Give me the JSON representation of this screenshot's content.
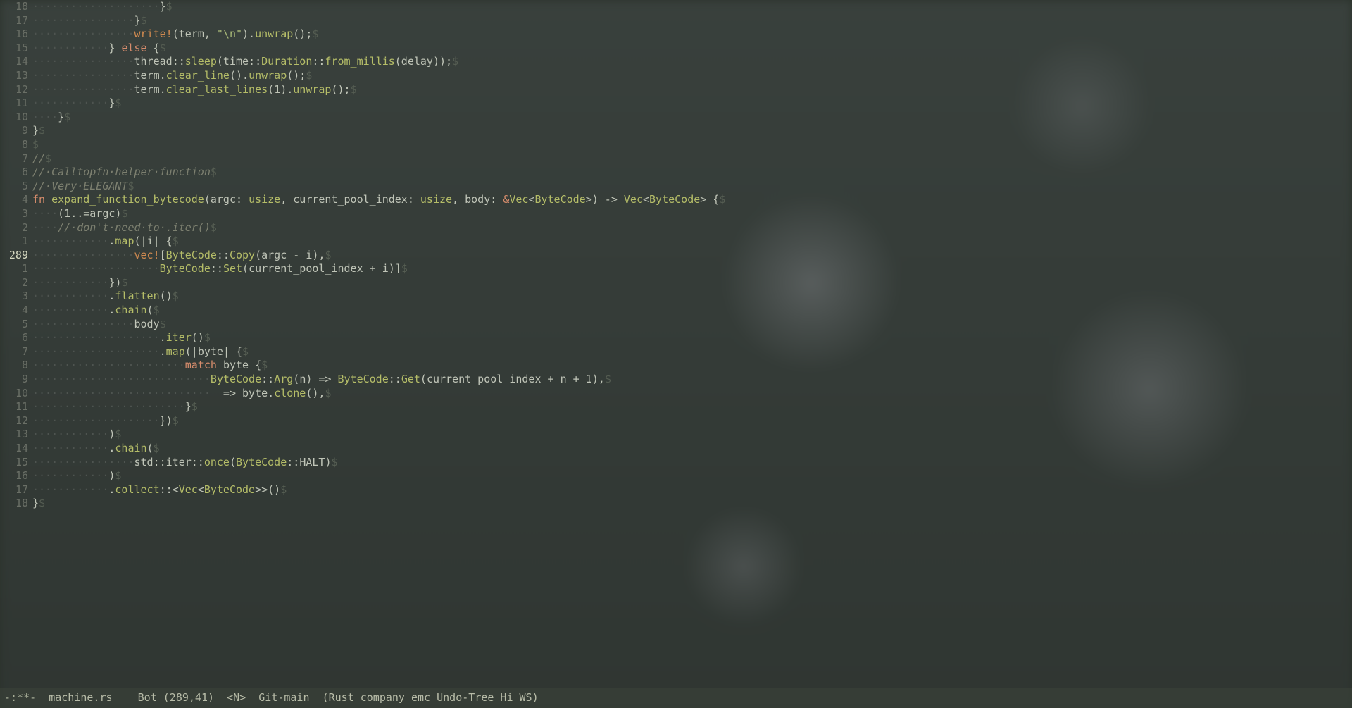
{
  "modeline": {
    "modified": "-:**-",
    "filename": "machine.rs",
    "position": "Bot (289,41)",
    "state": "<N>",
    "vcs": "Git-main",
    "modes": "(Rust company emc Undo-Tree Hi WS)"
  },
  "cursor_line_number": "289",
  "lines": [
    {
      "rel": "18",
      "indent": 20,
      "tokens": [
        {
          "cls": "op",
          "t": "}"
        }
      ]
    },
    {
      "rel": "17",
      "indent": 16,
      "tokens": [
        {
          "cls": "op",
          "t": "}"
        }
      ]
    },
    {
      "rel": "16",
      "indent": 16,
      "tokens": [
        {
          "cls": "mac",
          "t": "write!"
        },
        {
          "cls": "op",
          "t": "(term, "
        },
        {
          "cls": "str",
          "t": "\"\\n\""
        },
        {
          "cls": "op",
          "t": ")."
        },
        {
          "cls": "fn",
          "t": "unwrap"
        },
        {
          "cls": "op",
          "t": "();"
        }
      ]
    },
    {
      "rel": "15",
      "indent": 12,
      "tokens": [
        {
          "cls": "op",
          "t": "} "
        },
        {
          "cls": "kw",
          "t": "else"
        },
        {
          "cls": "op",
          "t": " {"
        }
      ]
    },
    {
      "rel": "14",
      "indent": 16,
      "tokens": [
        {
          "cls": "id",
          "t": "thread"
        },
        {
          "cls": "op",
          "t": "::"
        },
        {
          "cls": "fn",
          "t": "sleep"
        },
        {
          "cls": "op",
          "t": "(time::"
        },
        {
          "cls": "ty",
          "t": "Duration"
        },
        {
          "cls": "op",
          "t": "::"
        },
        {
          "cls": "fn",
          "t": "from_millis"
        },
        {
          "cls": "op",
          "t": "(delay));"
        }
      ]
    },
    {
      "rel": "13",
      "indent": 16,
      "tokens": [
        {
          "cls": "id",
          "t": "term"
        },
        {
          "cls": "op",
          "t": "."
        },
        {
          "cls": "fn",
          "t": "clear_line"
        },
        {
          "cls": "op",
          "t": "()"
        },
        {
          "cls": "op",
          "t": "."
        },
        {
          "cls": "fn",
          "t": "unwrap"
        },
        {
          "cls": "op",
          "t": "();"
        }
      ]
    },
    {
      "rel": "12",
      "indent": 16,
      "tokens": [
        {
          "cls": "id",
          "t": "term"
        },
        {
          "cls": "op",
          "t": "."
        },
        {
          "cls": "fn",
          "t": "clear_last_lines"
        },
        {
          "cls": "op",
          "t": "("
        },
        {
          "cls": "num",
          "t": "1"
        },
        {
          "cls": "op",
          "t": ")."
        },
        {
          "cls": "fn",
          "t": "unwrap"
        },
        {
          "cls": "op",
          "t": "();"
        }
      ]
    },
    {
      "rel": "11",
      "indent": 12,
      "tokens": [
        {
          "cls": "op",
          "t": "}"
        }
      ]
    },
    {
      "rel": "10",
      "indent": 4,
      "tokens": [
        {
          "cls": "op",
          "t": "}"
        }
      ]
    },
    {
      "rel": "9",
      "indent": 0,
      "tokens": [
        {
          "cls": "op",
          "t": "}"
        }
      ]
    },
    {
      "rel": "8",
      "indent": 0,
      "tokens": []
    },
    {
      "rel": "7",
      "indent": 0,
      "tokens": [
        {
          "cls": "cm",
          "t": "//"
        }
      ]
    },
    {
      "rel": "6",
      "indent": 0,
      "tokens": [
        {
          "cls": "cm",
          "t": "// Calltopfn helper function"
        }
      ]
    },
    {
      "rel": "5",
      "indent": 0,
      "tokens": [
        {
          "cls": "cm",
          "t": "// Very ELEGANT"
        }
      ]
    },
    {
      "rel": "4",
      "indent": 0,
      "tokens": [
        {
          "cls": "kw",
          "t": "fn"
        },
        {
          "cls": "op",
          "t": " "
        },
        {
          "cls": "fn",
          "t": "expand_function_bytecode"
        },
        {
          "cls": "op",
          "t": "("
        },
        {
          "cls": "id",
          "t": "argc"
        },
        {
          "cls": "op",
          "t": ": "
        },
        {
          "cls": "ty",
          "t": "usize"
        },
        {
          "cls": "op",
          "t": ", "
        },
        {
          "cls": "id",
          "t": "current_pool_index"
        },
        {
          "cls": "op",
          "t": ": "
        },
        {
          "cls": "ty",
          "t": "usize"
        },
        {
          "cls": "op",
          "t": ", "
        },
        {
          "cls": "id",
          "t": "body"
        },
        {
          "cls": "op",
          "t": ": "
        },
        {
          "cls": "kw",
          "t": "&"
        },
        {
          "cls": "ty",
          "t": "Vec"
        },
        {
          "cls": "op",
          "t": "<"
        },
        {
          "cls": "ty",
          "t": "ByteCode"
        },
        {
          "cls": "op",
          "t": ">) -> "
        },
        {
          "cls": "ty",
          "t": "Vec"
        },
        {
          "cls": "op",
          "t": "<"
        },
        {
          "cls": "ty",
          "t": "ByteCode"
        },
        {
          "cls": "op",
          "t": "> {"
        }
      ]
    },
    {
      "rel": "3",
      "indent": 4,
      "tokens": [
        {
          "cls": "op",
          "t": "("
        },
        {
          "cls": "num",
          "t": "1"
        },
        {
          "cls": "op",
          "t": "..="
        },
        {
          "cls": "id",
          "t": "argc"
        },
        {
          "cls": "op",
          "t": ")"
        }
      ]
    },
    {
      "rel": "2",
      "indent": 4,
      "tokens": [
        {
          "cls": "cm",
          "t": "// don't need to .iter()"
        }
      ]
    },
    {
      "rel": "1",
      "indent": 12,
      "tokens": [
        {
          "cls": "op",
          "t": "."
        },
        {
          "cls": "fn",
          "t": "map"
        },
        {
          "cls": "op",
          "t": "(|"
        },
        {
          "cls": "id",
          "t": "i"
        },
        {
          "cls": "op",
          "t": "| {"
        }
      ]
    },
    {
      "rel": "289",
      "indent": 16,
      "current": true,
      "tokens": [
        {
          "cls": "mac",
          "t": "vec!"
        },
        {
          "cls": "op",
          "t": "["
        },
        {
          "cls": "ty",
          "t": "ByteCode"
        },
        {
          "cls": "op",
          "t": "::"
        },
        {
          "cls": "fn",
          "t": "Copy"
        },
        {
          "cls": "op",
          "t": "("
        },
        {
          "cls": "id",
          "t": "argc"
        },
        {
          "cls": "op",
          "t": " - "
        },
        {
          "cls": "id",
          "t": "i"
        },
        {
          "cls": "op",
          "t": "),"
        }
      ]
    },
    {
      "rel": "1",
      "indent": 20,
      "tokens": [
        {
          "cls": "ty",
          "t": "ByteCode"
        },
        {
          "cls": "op",
          "t": "::"
        },
        {
          "cls": "fn",
          "t": "Set"
        },
        {
          "cls": "op",
          "t": "("
        },
        {
          "cls": "id",
          "t": "current_pool_index"
        },
        {
          "cls": "op",
          "t": " + "
        },
        {
          "cls": "id",
          "t": "i"
        },
        {
          "cls": "op",
          "t": ")]"
        }
      ]
    },
    {
      "rel": "2",
      "indent": 12,
      "tokens": [
        {
          "cls": "op",
          "t": "})"
        }
      ]
    },
    {
      "rel": "3",
      "indent": 12,
      "tokens": [
        {
          "cls": "op",
          "t": "."
        },
        {
          "cls": "fn",
          "t": "flatten"
        },
        {
          "cls": "op",
          "t": "()"
        }
      ]
    },
    {
      "rel": "4",
      "indent": 12,
      "tokens": [
        {
          "cls": "op",
          "t": "."
        },
        {
          "cls": "fn",
          "t": "chain"
        },
        {
          "cls": "op",
          "t": "("
        }
      ]
    },
    {
      "rel": "5",
      "indent": 16,
      "tokens": [
        {
          "cls": "id",
          "t": "body"
        }
      ]
    },
    {
      "rel": "6",
      "indent": 20,
      "tokens": [
        {
          "cls": "op",
          "t": "."
        },
        {
          "cls": "fn",
          "t": "iter"
        },
        {
          "cls": "op",
          "t": "()"
        }
      ]
    },
    {
      "rel": "7",
      "indent": 20,
      "tokens": [
        {
          "cls": "op",
          "t": "."
        },
        {
          "cls": "fn",
          "t": "map"
        },
        {
          "cls": "op",
          "t": "(|"
        },
        {
          "cls": "id",
          "t": "byte"
        },
        {
          "cls": "op",
          "t": "| {"
        }
      ]
    },
    {
      "rel": "8",
      "indent": 24,
      "tokens": [
        {
          "cls": "kw",
          "t": "match"
        },
        {
          "cls": "op",
          "t": " "
        },
        {
          "cls": "id",
          "t": "byte"
        },
        {
          "cls": "op",
          "t": " {"
        }
      ]
    },
    {
      "rel": "9",
      "indent": 28,
      "tokens": [
        {
          "cls": "ty",
          "t": "ByteCode"
        },
        {
          "cls": "op",
          "t": "::"
        },
        {
          "cls": "fn",
          "t": "Arg"
        },
        {
          "cls": "op",
          "t": "("
        },
        {
          "cls": "id",
          "t": "n"
        },
        {
          "cls": "op",
          "t": ") => "
        },
        {
          "cls": "ty",
          "t": "ByteCode"
        },
        {
          "cls": "op",
          "t": "::"
        },
        {
          "cls": "fn",
          "t": "Get"
        },
        {
          "cls": "op",
          "t": "("
        },
        {
          "cls": "id",
          "t": "current_pool_index"
        },
        {
          "cls": "op",
          "t": " + "
        },
        {
          "cls": "id",
          "t": "n"
        },
        {
          "cls": "op",
          "t": " + "
        },
        {
          "cls": "num",
          "t": "1"
        },
        {
          "cls": "op",
          "t": "),"
        }
      ]
    },
    {
      "rel": "10",
      "indent": 28,
      "tokens": [
        {
          "cls": "op",
          "t": "_ => "
        },
        {
          "cls": "id",
          "t": "byte"
        },
        {
          "cls": "op",
          "t": "."
        },
        {
          "cls": "fn",
          "t": "clone"
        },
        {
          "cls": "op",
          "t": "(),"
        }
      ]
    },
    {
      "rel": "11",
      "indent": 24,
      "tokens": [
        {
          "cls": "op",
          "t": "}"
        }
      ]
    },
    {
      "rel": "12",
      "indent": 20,
      "tokens": [
        {
          "cls": "op",
          "t": "})"
        }
      ]
    },
    {
      "rel": "13",
      "indent": 12,
      "tokens": [
        {
          "cls": "op",
          "t": ")"
        }
      ]
    },
    {
      "rel": "14",
      "indent": 12,
      "tokens": [
        {
          "cls": "op",
          "t": "."
        },
        {
          "cls": "fn",
          "t": "chain"
        },
        {
          "cls": "op",
          "t": "("
        }
      ]
    },
    {
      "rel": "15",
      "indent": 16,
      "tokens": [
        {
          "cls": "id",
          "t": "std"
        },
        {
          "cls": "op",
          "t": "::"
        },
        {
          "cls": "id",
          "t": "iter"
        },
        {
          "cls": "op",
          "t": "::"
        },
        {
          "cls": "fn",
          "t": "once"
        },
        {
          "cls": "op",
          "t": "("
        },
        {
          "cls": "ty",
          "t": "ByteCode"
        },
        {
          "cls": "op",
          "t": "::"
        },
        {
          "cls": "id",
          "t": "HALT"
        },
        {
          "cls": "op",
          "t": ")"
        }
      ]
    },
    {
      "rel": "16",
      "indent": 12,
      "tokens": [
        {
          "cls": "op",
          "t": ")"
        }
      ]
    },
    {
      "rel": "17",
      "indent": 12,
      "tokens": [
        {
          "cls": "op",
          "t": "."
        },
        {
          "cls": "fn",
          "t": "collect"
        },
        {
          "cls": "op",
          "t": "::"
        },
        {
          "cls": "op",
          "t": "<"
        },
        {
          "cls": "ty",
          "t": "Vec"
        },
        {
          "cls": "op",
          "t": "<"
        },
        {
          "cls": "ty",
          "t": "ByteCode"
        },
        {
          "cls": "op",
          "t": ">>()"
        }
      ]
    },
    {
      "rel": "18",
      "indent": 0,
      "tokens": [
        {
          "cls": "op",
          "t": "}"
        }
      ]
    }
  ]
}
